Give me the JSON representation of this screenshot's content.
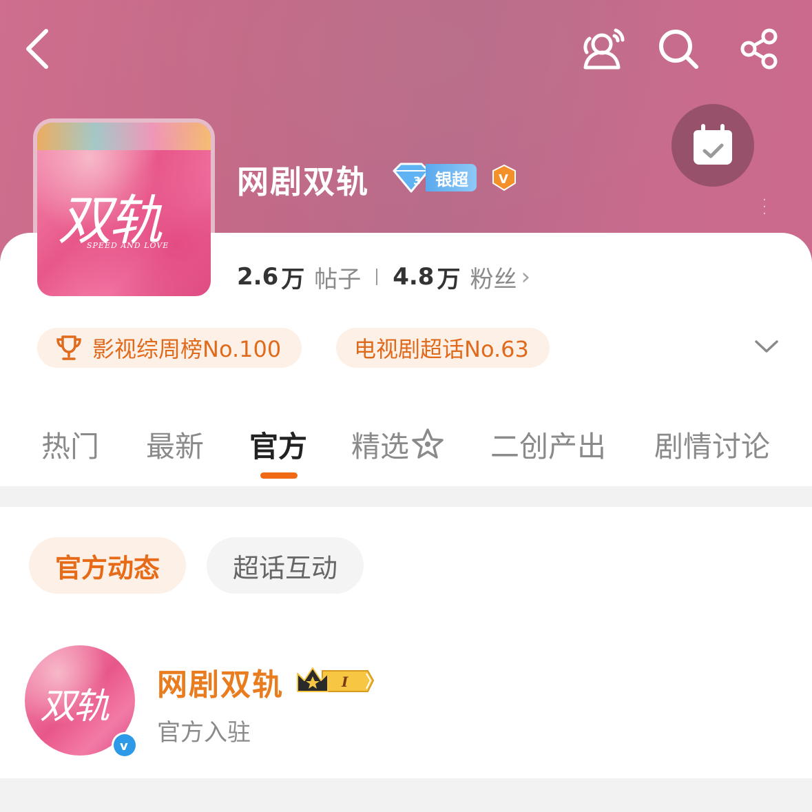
{
  "header": {
    "cover_art_text": "双轨",
    "cover_art_subtext": "SPEED AND LOVE"
  },
  "topic": {
    "title": "网剧双轨",
    "level_label": "银超",
    "level_number": "3",
    "verified_mark": "V"
  },
  "stats": {
    "posts_number": "2.6",
    "posts_unit": "万",
    "posts_label": "帖子",
    "fans_number": "4.8",
    "fans_unit": "万",
    "fans_label": "粉丝",
    "arrow": "›"
  },
  "ranks": [
    {
      "label": "影视综周榜No.100"
    },
    {
      "label": "电视剧超话No.63"
    }
  ],
  "tabs": [
    {
      "label": "热门"
    },
    {
      "label": "最新"
    },
    {
      "label": "官方"
    },
    {
      "label": "精选"
    },
    {
      "label": "二创产出"
    },
    {
      "label": "剧情讨论"
    }
  ],
  "active_tab": "官方",
  "filters": [
    {
      "label": "官方动态"
    },
    {
      "label": "超话互动"
    }
  ],
  "account": {
    "name": "网剧双轨",
    "crown_level": "I",
    "description": "官方入驻",
    "verified_mark": "v"
  },
  "colors": {
    "accent": "#e76a17",
    "account_name": "#e87c1f",
    "header_pink": "#c46a88"
  }
}
